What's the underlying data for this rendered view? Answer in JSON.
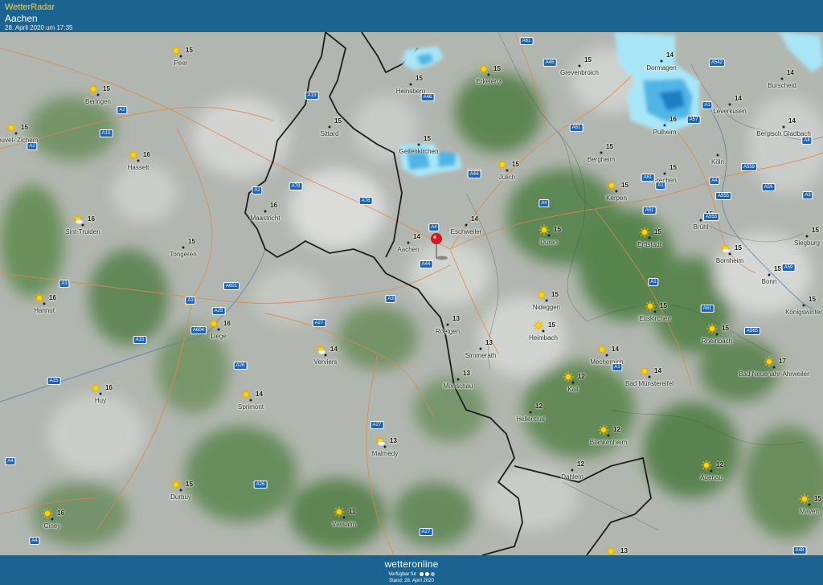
{
  "header": {
    "app_title": "WetterRadar",
    "place": "Aachen",
    "timestamp": "28. April 2020 um 17:35"
  },
  "footer": {
    "brand": "wetteronline",
    "availability": "Verfügbar für",
    "edition": "Stand: 28. April 2020"
  },
  "colors": {
    "header_bg": "#1b6391",
    "accent": "#ffd23c",
    "precip": "#4fb5e6",
    "marker": "#e0161e"
  },
  "selected_location": "Aachen",
  "places": [
    {
      "name": "Peer",
      "temp": "15",
      "icon": "sun-icon"
    },
    {
      "name": "Beringen",
      "temp": "15",
      "icon": "sun-icon"
    },
    {
      "name": "Heusden-Zolder",
      "label": "heuvel- Zichem",
      "temp": "15",
      "icon": "sun-icon"
    },
    {
      "name": "Hasselt",
      "temp": "16",
      "icon": "sun-icon"
    },
    {
      "name": "Sint-Truiden",
      "temp": "16",
      "icon": "partly-cloudy-icon"
    },
    {
      "name": "Tongeren",
      "temp": "15",
      "icon": ""
    },
    {
      "name": "Hannut",
      "temp": "16",
      "icon": "sun-icon"
    },
    {
      "name": "Liege",
      "temp": "16",
      "icon": "sun-icon"
    },
    {
      "name": "Huy",
      "temp": "16",
      "icon": "sun-icon"
    },
    {
      "name": "Sprimont",
      "temp": "14",
      "icon": "sun-icon"
    },
    {
      "name": "Durbuy",
      "temp": "15",
      "icon": "sun-icon"
    },
    {
      "name": "Ciney",
      "temp": "16",
      "icon": "sun-icon"
    },
    {
      "name": "Vielsalm",
      "temp": "11",
      "icon": "sun-icon"
    },
    {
      "name": "Malmedy",
      "temp": "13",
      "icon": "partly-cloudy-icon"
    },
    {
      "name": "Verviers",
      "temp": "14",
      "icon": "partly-cloudy-icon"
    },
    {
      "name": "Maastricht",
      "temp": "16",
      "icon": ""
    },
    {
      "name": "Sittard",
      "temp": "15",
      "icon": ""
    },
    {
      "name": "Heinsberg",
      "temp": "15",
      "icon": ""
    },
    {
      "name": "Geilenkirchen",
      "temp": "15",
      "icon": ""
    },
    {
      "name": "Aachen",
      "temp": "14",
      "icon": ""
    },
    {
      "name": "Eschweiler",
      "temp": "14",
      "icon": ""
    },
    {
      "name": "Roetgen",
      "temp": "13",
      "icon": ""
    },
    {
      "name": "Simmerath",
      "temp": "13",
      "icon": ""
    },
    {
      "name": "Monschau",
      "temp": "13",
      "icon": ""
    },
    {
      "name": "Erkelenz",
      "temp": "15",
      "icon": "sun-icon"
    },
    {
      "name": "Grevenbroich",
      "temp": "15",
      "icon": ""
    },
    {
      "name": "Juelich",
      "label": "Jülich",
      "temp": "15",
      "icon": "sun-icon"
    },
    {
      "name": "Dueren",
      "label": "Düren",
      "temp": "15",
      "icon": "sun-icon"
    },
    {
      "name": "Nideggen",
      "temp": "15",
      "icon": "sun-icon"
    },
    {
      "name": "Heimbach",
      "temp": "15",
      "icon": "sun-icon"
    },
    {
      "name": "Hellenthal",
      "temp": "12",
      "icon": ""
    },
    {
      "name": "Bergheim",
      "temp": "15",
      "icon": ""
    },
    {
      "name": "Kerpen",
      "temp": "15",
      "icon": "sun-icon"
    },
    {
      "name": "Erftstadt",
      "temp": "15",
      "icon": "sun-icon"
    },
    {
      "name": "Frechen",
      "temp": "15",
      "icon": ""
    },
    {
      "name": "Bruehl",
      "label": "Brühl",
      "temp": "15",
      "icon": ""
    },
    {
      "name": "Mechernich",
      "temp": "14",
      "icon": "sun-icon"
    },
    {
      "name": "Euskirchen",
      "temp": "15",
      "icon": "sun-icon"
    },
    {
      "name": "Kall",
      "temp": "12",
      "icon": "sun-icon"
    },
    {
      "name": "Bad Muenstereifel",
      "label": "Bad Münstereifel",
      "temp": "14",
      "icon": "sun-icon"
    },
    {
      "name": "Blankenheim",
      "temp": "12",
      "icon": "sun-icon"
    },
    {
      "name": "Dahlem",
      "temp": "12",
      "icon": ""
    },
    {
      "name": "Dormagen",
      "temp": "14",
      "icon": ""
    },
    {
      "name": "Pulheim",
      "temp": "16",
      "icon": ""
    },
    {
      "name": "Koeln",
      "label": "Köln",
      "temp": "",
      "icon": ""
    },
    {
      "name": "Leverkusen",
      "temp": "14",
      "icon": ""
    },
    {
      "name": "Burscheid",
      "temp": "14",
      "icon": ""
    },
    {
      "name": "Bergisch Gladbach",
      "temp": "14",
      "icon": ""
    },
    {
      "name": "Bornheim",
      "temp": "15",
      "icon": "partly-cloudy-icon"
    },
    {
      "name": "Siegburg",
      "temp": "15",
      "icon": ""
    },
    {
      "name": "Bonn",
      "temp": "15",
      "icon": ""
    },
    {
      "name": "Koenigswinter",
      "label": "Königswinter",
      "temp": "15",
      "icon": ""
    },
    {
      "name": "Rheinbach",
      "temp": "15",
      "icon": "sun-icon"
    },
    {
      "name": "Bad Neuenahr-Ahrweiler",
      "temp": "17",
      "icon": "sun-icon"
    },
    {
      "name": "Adenau",
      "temp": "12",
      "icon": "sun-icon"
    },
    {
      "name": "Mayen",
      "temp": "15",
      "icon": "sun-icon"
    },
    {
      "name": "bottom-edge",
      "label": "",
      "temp": "13",
      "icon": "sun-icon"
    }
  ],
  "roads": [
    "A2",
    "A2",
    "A13",
    "A13",
    "A2",
    "A79",
    "A76",
    "A4",
    "A44",
    "A44",
    "A46",
    "A61",
    "A46",
    "A61",
    "A44",
    "A4",
    "A61",
    "A1",
    "A4",
    "A57",
    "A1",
    "A542",
    "A61",
    "A555",
    "A559",
    "A59",
    "A3",
    "A4",
    "A553",
    "A565",
    "A59",
    "A61",
    "A1",
    "A1",
    "A3",
    "A3",
    "A601",
    "A25",
    "A604",
    "A15",
    "A27",
    "A26",
    "A15",
    "A27",
    "A26",
    "A4",
    "A4",
    "A27",
    "A48",
    "A3"
  ]
}
